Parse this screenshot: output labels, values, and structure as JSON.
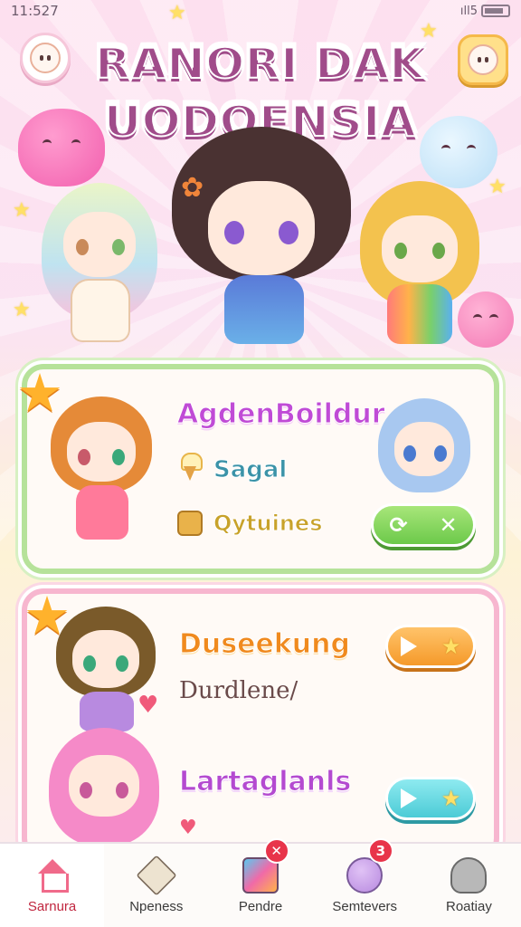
{
  "status_bar": {
    "time": "11:527",
    "signal": "ıll5"
  },
  "title": {
    "line1": "RANORI DAK",
    "line2": "UODOENSIA"
  },
  "panel_1": {
    "title": "AgdenBoildur",
    "item_1": "Sagal",
    "item_2": "Qytuines"
  },
  "panel_2": {
    "title": "Duseekung",
    "subtitle": "Durdlene/",
    "title_2": "Lartaglanls"
  },
  "bottom_nav": {
    "items": [
      {
        "label": "Sarnura",
        "icon": "home-icon"
      },
      {
        "label": "Npeness",
        "icon": "cube-icon"
      },
      {
        "label": "Pendre",
        "icon": "paint-brush-icon",
        "badge": "✕"
      },
      {
        "label": "Semtevers",
        "icon": "blob-icon",
        "badge": "3"
      },
      {
        "label": "Roatiay",
        "icon": "robot-icon"
      }
    ]
  },
  "colors": {
    "accent_pink": "#e3449a",
    "panel_green_border": "#b6e29a",
    "panel_pink_border": "#f7b6cf",
    "badge_red": "#e8344a"
  }
}
